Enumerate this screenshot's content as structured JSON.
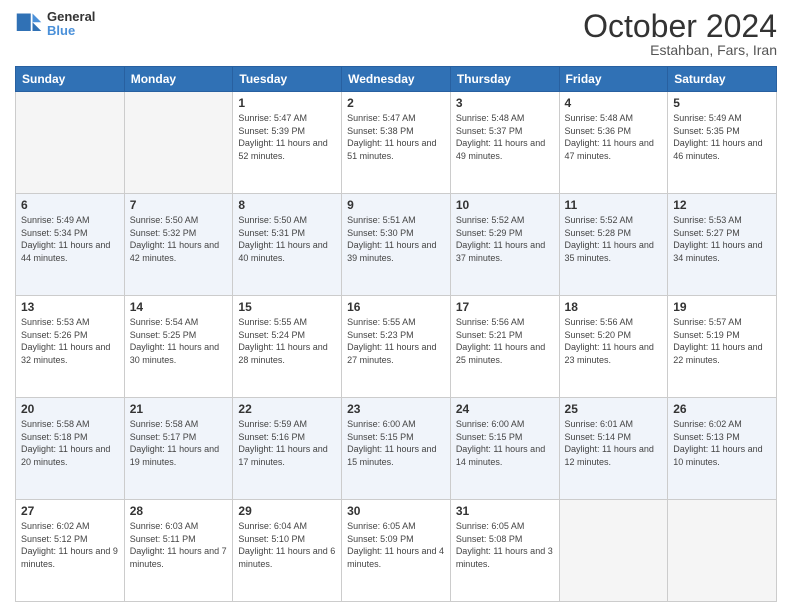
{
  "header": {
    "logo": {
      "line1": "General",
      "line2": "Blue"
    },
    "title": "October 2024",
    "subtitle": "Estahban, Fars, Iran"
  },
  "weekdays": [
    "Sunday",
    "Monday",
    "Tuesday",
    "Wednesday",
    "Thursday",
    "Friday",
    "Saturday"
  ],
  "weeks": [
    [
      {
        "day": "",
        "sunrise": "",
        "sunset": "",
        "daylight": ""
      },
      {
        "day": "",
        "sunrise": "",
        "sunset": "",
        "daylight": ""
      },
      {
        "day": "1",
        "sunrise": "Sunrise: 5:47 AM",
        "sunset": "Sunset: 5:39 PM",
        "daylight": "Daylight: 11 hours and 52 minutes."
      },
      {
        "day": "2",
        "sunrise": "Sunrise: 5:47 AM",
        "sunset": "Sunset: 5:38 PM",
        "daylight": "Daylight: 11 hours and 51 minutes."
      },
      {
        "day": "3",
        "sunrise": "Sunrise: 5:48 AM",
        "sunset": "Sunset: 5:37 PM",
        "daylight": "Daylight: 11 hours and 49 minutes."
      },
      {
        "day": "4",
        "sunrise": "Sunrise: 5:48 AM",
        "sunset": "Sunset: 5:36 PM",
        "daylight": "Daylight: 11 hours and 47 minutes."
      },
      {
        "day": "5",
        "sunrise": "Sunrise: 5:49 AM",
        "sunset": "Sunset: 5:35 PM",
        "daylight": "Daylight: 11 hours and 46 minutes."
      }
    ],
    [
      {
        "day": "6",
        "sunrise": "Sunrise: 5:49 AM",
        "sunset": "Sunset: 5:34 PM",
        "daylight": "Daylight: 11 hours and 44 minutes."
      },
      {
        "day": "7",
        "sunrise": "Sunrise: 5:50 AM",
        "sunset": "Sunset: 5:32 PM",
        "daylight": "Daylight: 11 hours and 42 minutes."
      },
      {
        "day": "8",
        "sunrise": "Sunrise: 5:50 AM",
        "sunset": "Sunset: 5:31 PM",
        "daylight": "Daylight: 11 hours and 40 minutes."
      },
      {
        "day": "9",
        "sunrise": "Sunrise: 5:51 AM",
        "sunset": "Sunset: 5:30 PM",
        "daylight": "Daylight: 11 hours and 39 minutes."
      },
      {
        "day": "10",
        "sunrise": "Sunrise: 5:52 AM",
        "sunset": "Sunset: 5:29 PM",
        "daylight": "Daylight: 11 hours and 37 minutes."
      },
      {
        "day": "11",
        "sunrise": "Sunrise: 5:52 AM",
        "sunset": "Sunset: 5:28 PM",
        "daylight": "Daylight: 11 hours and 35 minutes."
      },
      {
        "day": "12",
        "sunrise": "Sunrise: 5:53 AM",
        "sunset": "Sunset: 5:27 PM",
        "daylight": "Daylight: 11 hours and 34 minutes."
      }
    ],
    [
      {
        "day": "13",
        "sunrise": "Sunrise: 5:53 AM",
        "sunset": "Sunset: 5:26 PM",
        "daylight": "Daylight: 11 hours and 32 minutes."
      },
      {
        "day": "14",
        "sunrise": "Sunrise: 5:54 AM",
        "sunset": "Sunset: 5:25 PM",
        "daylight": "Daylight: 11 hours and 30 minutes."
      },
      {
        "day": "15",
        "sunrise": "Sunrise: 5:55 AM",
        "sunset": "Sunset: 5:24 PM",
        "daylight": "Daylight: 11 hours and 28 minutes."
      },
      {
        "day": "16",
        "sunrise": "Sunrise: 5:55 AM",
        "sunset": "Sunset: 5:23 PM",
        "daylight": "Daylight: 11 hours and 27 minutes."
      },
      {
        "day": "17",
        "sunrise": "Sunrise: 5:56 AM",
        "sunset": "Sunset: 5:21 PM",
        "daylight": "Daylight: 11 hours and 25 minutes."
      },
      {
        "day": "18",
        "sunrise": "Sunrise: 5:56 AM",
        "sunset": "Sunset: 5:20 PM",
        "daylight": "Daylight: 11 hours and 23 minutes."
      },
      {
        "day": "19",
        "sunrise": "Sunrise: 5:57 AM",
        "sunset": "Sunset: 5:19 PM",
        "daylight": "Daylight: 11 hours and 22 minutes."
      }
    ],
    [
      {
        "day": "20",
        "sunrise": "Sunrise: 5:58 AM",
        "sunset": "Sunset: 5:18 PM",
        "daylight": "Daylight: 11 hours and 20 minutes."
      },
      {
        "day": "21",
        "sunrise": "Sunrise: 5:58 AM",
        "sunset": "Sunset: 5:17 PM",
        "daylight": "Daylight: 11 hours and 19 minutes."
      },
      {
        "day": "22",
        "sunrise": "Sunrise: 5:59 AM",
        "sunset": "Sunset: 5:16 PM",
        "daylight": "Daylight: 11 hours and 17 minutes."
      },
      {
        "day": "23",
        "sunrise": "Sunrise: 6:00 AM",
        "sunset": "Sunset: 5:15 PM",
        "daylight": "Daylight: 11 hours and 15 minutes."
      },
      {
        "day": "24",
        "sunrise": "Sunrise: 6:00 AM",
        "sunset": "Sunset: 5:15 PM",
        "daylight": "Daylight: 11 hours and 14 minutes."
      },
      {
        "day": "25",
        "sunrise": "Sunrise: 6:01 AM",
        "sunset": "Sunset: 5:14 PM",
        "daylight": "Daylight: 11 hours and 12 minutes."
      },
      {
        "day": "26",
        "sunrise": "Sunrise: 6:02 AM",
        "sunset": "Sunset: 5:13 PM",
        "daylight": "Daylight: 11 hours and 10 minutes."
      }
    ],
    [
      {
        "day": "27",
        "sunrise": "Sunrise: 6:02 AM",
        "sunset": "Sunset: 5:12 PM",
        "daylight": "Daylight: 11 hours and 9 minutes."
      },
      {
        "day": "28",
        "sunrise": "Sunrise: 6:03 AM",
        "sunset": "Sunset: 5:11 PM",
        "daylight": "Daylight: 11 hours and 7 minutes."
      },
      {
        "day": "29",
        "sunrise": "Sunrise: 6:04 AM",
        "sunset": "Sunset: 5:10 PM",
        "daylight": "Daylight: 11 hours and 6 minutes."
      },
      {
        "day": "30",
        "sunrise": "Sunrise: 6:05 AM",
        "sunset": "Sunset: 5:09 PM",
        "daylight": "Daylight: 11 hours and 4 minutes."
      },
      {
        "day": "31",
        "sunrise": "Sunrise: 6:05 AM",
        "sunset": "Sunset: 5:08 PM",
        "daylight": "Daylight: 11 hours and 3 minutes."
      },
      {
        "day": "",
        "sunrise": "",
        "sunset": "",
        "daylight": ""
      },
      {
        "day": "",
        "sunrise": "",
        "sunset": "",
        "daylight": ""
      }
    ]
  ]
}
